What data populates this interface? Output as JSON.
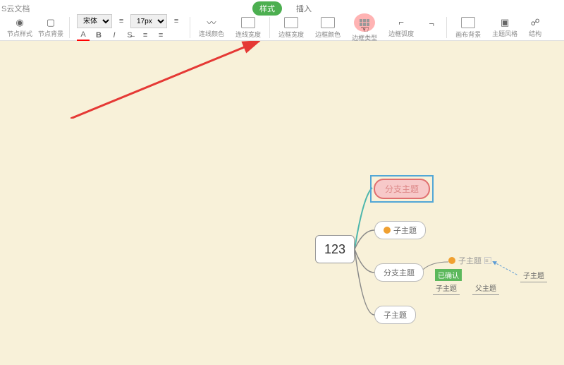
{
  "doc_title": "S云文档",
  "tabs": {
    "active": "样式",
    "inactive": "插入"
  },
  "toolbar": {
    "node_style": "节点样式",
    "node_bg": "节点背景",
    "font_name": "宋体",
    "font_size": "17px",
    "line_color": "连线颜色",
    "line_width": "连线宽度",
    "border_width": "边框宽度",
    "border_color": "边框颜色",
    "border_type": "边框类型",
    "border_radius": "边框弧度",
    "canvas_bg": "画布背景",
    "theme_style": "主题风格",
    "structure": "结构"
  },
  "mindmap": {
    "root": "123",
    "branch_selected": "分支主题",
    "child1": "子主题",
    "branch2": "分支主题",
    "child3": "子主题",
    "detail_child": "子主题",
    "tag": "已确认",
    "sub1": "子主题",
    "sub2": "父主题",
    "sub3": "子主题"
  }
}
